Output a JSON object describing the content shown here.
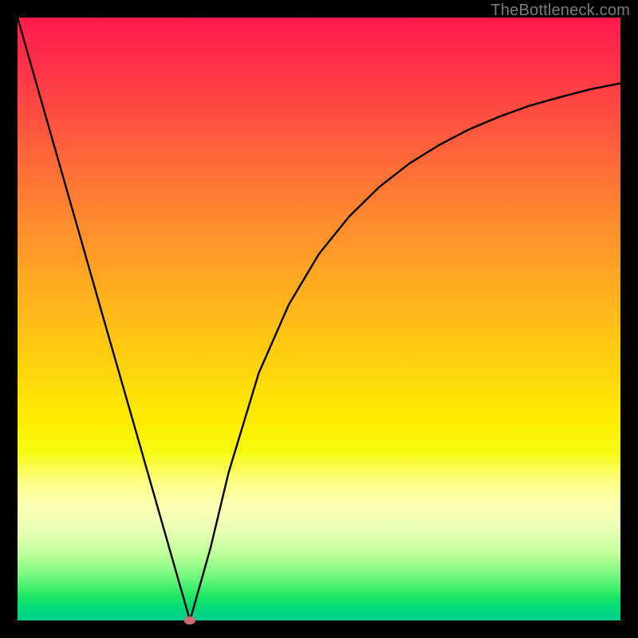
{
  "watermark": "TheBottleneck.com",
  "colors": {
    "frame_bg": "#000000",
    "curve_stroke": "#000000",
    "minpoint_fill": "#cf6d75"
  },
  "chart_data": {
    "type": "line",
    "title": "",
    "xlabel": "",
    "ylabel": "",
    "xlim": [
      0,
      100
    ],
    "ylim": [
      0,
      100
    ],
    "grid": false,
    "legend": null,
    "series": [
      {
        "name": "curve",
        "x": [
          0,
          5,
          10,
          15,
          20,
          25,
          28.6,
          32,
          35,
          40,
          45,
          50,
          55,
          60,
          65,
          70,
          75,
          80,
          85,
          90,
          95,
          100
        ],
        "y": [
          100,
          82.5,
          65.0,
          47.5,
          30.1,
          12.6,
          0,
          12,
          24.5,
          41.0,
          52.4,
          60.8,
          67.0,
          71.9,
          75.8,
          78.9,
          81.5,
          83.6,
          85.4,
          86.8,
          88.1,
          89.1
        ]
      }
    ],
    "annotations": [
      {
        "type": "point",
        "name": "minimum",
        "x": 28.6,
        "y": 0
      }
    ]
  }
}
